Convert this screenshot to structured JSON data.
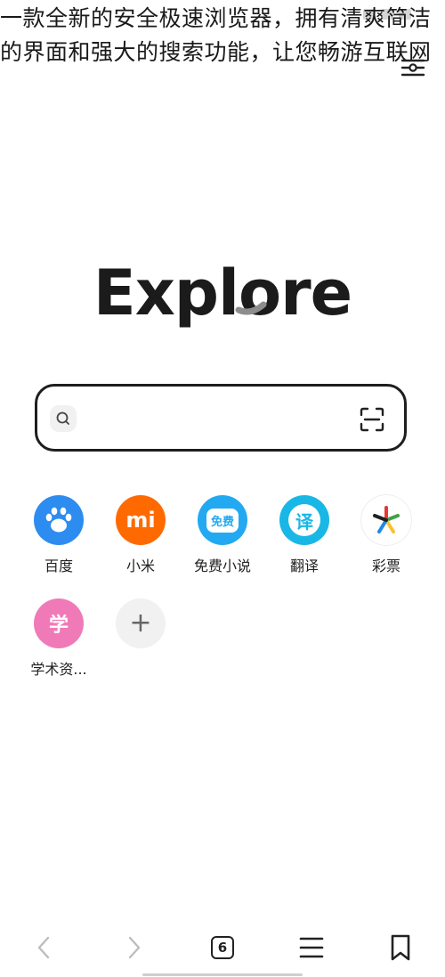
{
  "overlay": {
    "caption": "一款全新的安全极速浏览器，拥有清爽简洁的界面和强大的搜索功能，让您畅游互联网"
  },
  "header": {
    "menu_icon": "menu-settings-icon"
  },
  "logo": {
    "text": "Explore"
  },
  "search": {
    "placeholder": "",
    "left_icon": "search-icon",
    "right_icon": "scan-icon"
  },
  "shortcuts": [
    {
      "label": "百度",
      "icon": "baidu-paw-icon",
      "color": "#2d8cf0"
    },
    {
      "label": "小米",
      "icon": "xiaomi-mi-icon",
      "color": "#ff6a00"
    },
    {
      "label": "免费小说",
      "icon": "free-novel-icon",
      "color": "#23a9f2"
    },
    {
      "label": "翻译",
      "icon": "translate-icon",
      "color": "#19b7e6"
    },
    {
      "label": "彩票",
      "icon": "lottery-icon",
      "color": "#ffffff"
    },
    {
      "label": "学术资...",
      "icon": "academic-icon",
      "color": "#f07ab8"
    },
    {
      "label": "",
      "icon": "add-icon",
      "color": "#f1f1f1"
    }
  ],
  "icon_text": {
    "xiaomi": "mi",
    "novel": "免费",
    "translate": "译",
    "academic": "学",
    "add": "+"
  },
  "bottom_nav": {
    "back_icon": "back-icon",
    "forward_icon": "forward-icon",
    "tabs_count": "6",
    "menu_icon": "menu-icon",
    "bookmark_icon": "bookmark-icon"
  }
}
